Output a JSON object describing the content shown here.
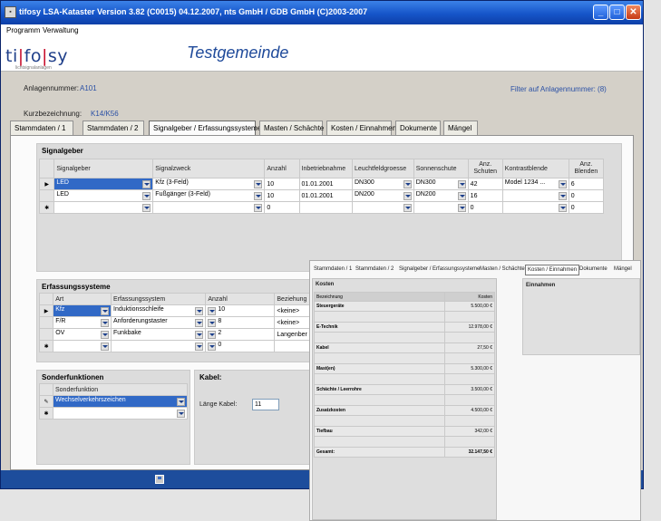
{
  "window": {
    "title": "tifosy LSA-Kataster Version 3.82 (C0015) 04.12.2007, nts GmbH / GDB GmbH (C)2003-2007"
  },
  "menu": [
    "Programm",
    "Verwaltung"
  ],
  "header": {
    "logo_text": "ti|fo|sy",
    "logo_subtitle": "lichtsignalanlagen",
    "title": "Testgemeinde"
  },
  "form": {
    "anlagennummer_label": "Anlagennummer:",
    "anlagennummer_value": "A101",
    "kurzbezeichnung_label": "Kurzbezeichnung:",
    "kurzbezeichnung_value": "K14/K56",
    "filter_text": "Filter auf Anlagennummer: (8)"
  },
  "tabs": [
    "Stammdaten / 1",
    "Stammdaten / 2",
    "Signalgeber / Erfassungssysteme",
    "Masten / Schächte",
    "Kosten / Einnahmen",
    "Dokumente",
    "Mängel"
  ],
  "signalgeber": {
    "title": "Signalgeber",
    "columns": [
      "Signalgeber",
      "Signalzweck",
      "Anzahl",
      "Inbetriebnahme",
      "Leuchtfeldgroesse",
      "Sonnenschute",
      "Anz. Schuten",
      "Kontrastblende",
      "Anz. Blenden"
    ],
    "rows": [
      [
        "LED",
        "Kfz (3-Feld)",
        "10",
        "01.01.2001",
        "DN300",
        "DN300",
        "42",
        "Model 1234 ...",
        "6"
      ],
      [
        "LED",
        "Fußgänger (3-Feld)",
        "10",
        "01.01.2001",
        "DN200",
        "DN200",
        "16",
        "",
        "0"
      ],
      [
        "",
        "",
        "0",
        "",
        "",
        "",
        "0",
        "",
        "0"
      ]
    ]
  },
  "erfassung": {
    "title": "Erfassungssysteme",
    "columns": [
      "Art",
      "Erfassungssystem",
      "Anzahl",
      "Beziehung"
    ],
    "rows": [
      [
        "Kfz",
        "Induktionsschleife",
        "10",
        "<keine>"
      ],
      [
        "F/R",
        "Anforderungstaster",
        "8",
        "<keine>"
      ],
      [
        "ÖV",
        "Funkbake",
        "2",
        "Langenber"
      ],
      [
        "",
        "",
        "0",
        ""
      ]
    ]
  },
  "sonderfunktionen": {
    "title": "Sonderfunktionen",
    "column": "Sonderfunktion",
    "rows": [
      "Wechselverkehrszeichen",
      ""
    ]
  },
  "kabel": {
    "title": "Kabel:",
    "laenge_label": "Länge Kabel:",
    "laenge_value": "11"
  },
  "overlay": {
    "tabs": [
      "Stammdaten / 1",
      "Stammdaten / 2",
      "Signalgeber / Erfassungssysteme",
      "Masten / Schächte",
      "Kosten / Einnahmen",
      "Dokumente",
      "Mängel"
    ],
    "kosten_title": "Kosten",
    "col_bezeichnung": "Bezeichnung",
    "col_kosten": "Kosten",
    "items": [
      {
        "name": "Steuergeräte",
        "amount": "5.500,00 €"
      },
      {
        "name": "E-Technik",
        "amount": "12.978,00 €"
      },
      {
        "name": "Kabel",
        "amount": "27,50 €"
      },
      {
        "name": "Mast(en)",
        "amount": "5.300,00 €"
      },
      {
        "name": "Schächte / Leerrohre",
        "amount": "3.500,00 €"
      },
      {
        "name": "Zusatzkosten",
        "amount": "4.500,00 €"
      },
      {
        "name": "Tiefbau",
        "amount": "342,00 €"
      },
      {
        "name": "Gesamt:",
        "amount": "32.147,50 €"
      }
    ],
    "einnahmen_title": "Einnahmen"
  },
  "colors": {
    "titlebar": "#1655c9",
    "accent_text": "#2a50a5",
    "selection": "#3169c6",
    "statusbar": "#1d4d9c"
  },
  "icons": [
    "app-icon",
    "minimize-icon",
    "maximize-icon",
    "close-icon",
    "save-icon",
    "dropdown-arrow-icon",
    "row-pointer-icon",
    "new-row-icon",
    "edit-pencil-icon"
  ]
}
